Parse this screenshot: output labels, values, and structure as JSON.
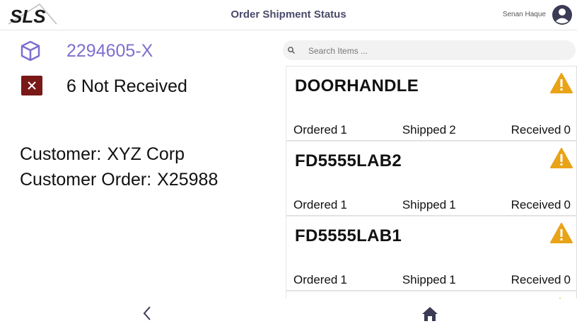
{
  "header": {
    "logo_text": "SLS",
    "title": "Order Shipment Status",
    "user_name": "Senan Haque"
  },
  "order": {
    "id": "2294605-X",
    "status": "6 Not Received",
    "customer_label": "Customer:",
    "customer_value": "XYZ Corp",
    "customer_order_label": "Customer Order:",
    "customer_order_value": "X25988"
  },
  "search": {
    "placeholder": "Search Items ..."
  },
  "items": [
    {
      "name": "DOORHANDLE",
      "ordered_label": "Ordered",
      "ordered": "1",
      "shipped_label": "Shipped",
      "shipped": "2",
      "received_label": "Received",
      "received": "0"
    },
    {
      "name": "FD5555LAB2",
      "ordered_label": "Ordered",
      "ordered": "1",
      "shipped_label": "Shipped",
      "shipped": "1",
      "received_label": "Received",
      "received": "0"
    },
    {
      "name": "FD5555LAB1",
      "ordered_label": "Ordered",
      "ordered": "1",
      "shipped_label": "Shipped",
      "shipped": "1",
      "received_label": "Received",
      "received": "0"
    }
  ],
  "colors": {
    "accent": "#7d6fcf",
    "warning": "#e8a317",
    "error": "#7a1818",
    "title": "#4a4a6a"
  },
  "icons": [
    "box-icon",
    "x-icon",
    "search-icon",
    "warning-icon",
    "avatar-icon",
    "back-icon",
    "home-icon"
  ]
}
